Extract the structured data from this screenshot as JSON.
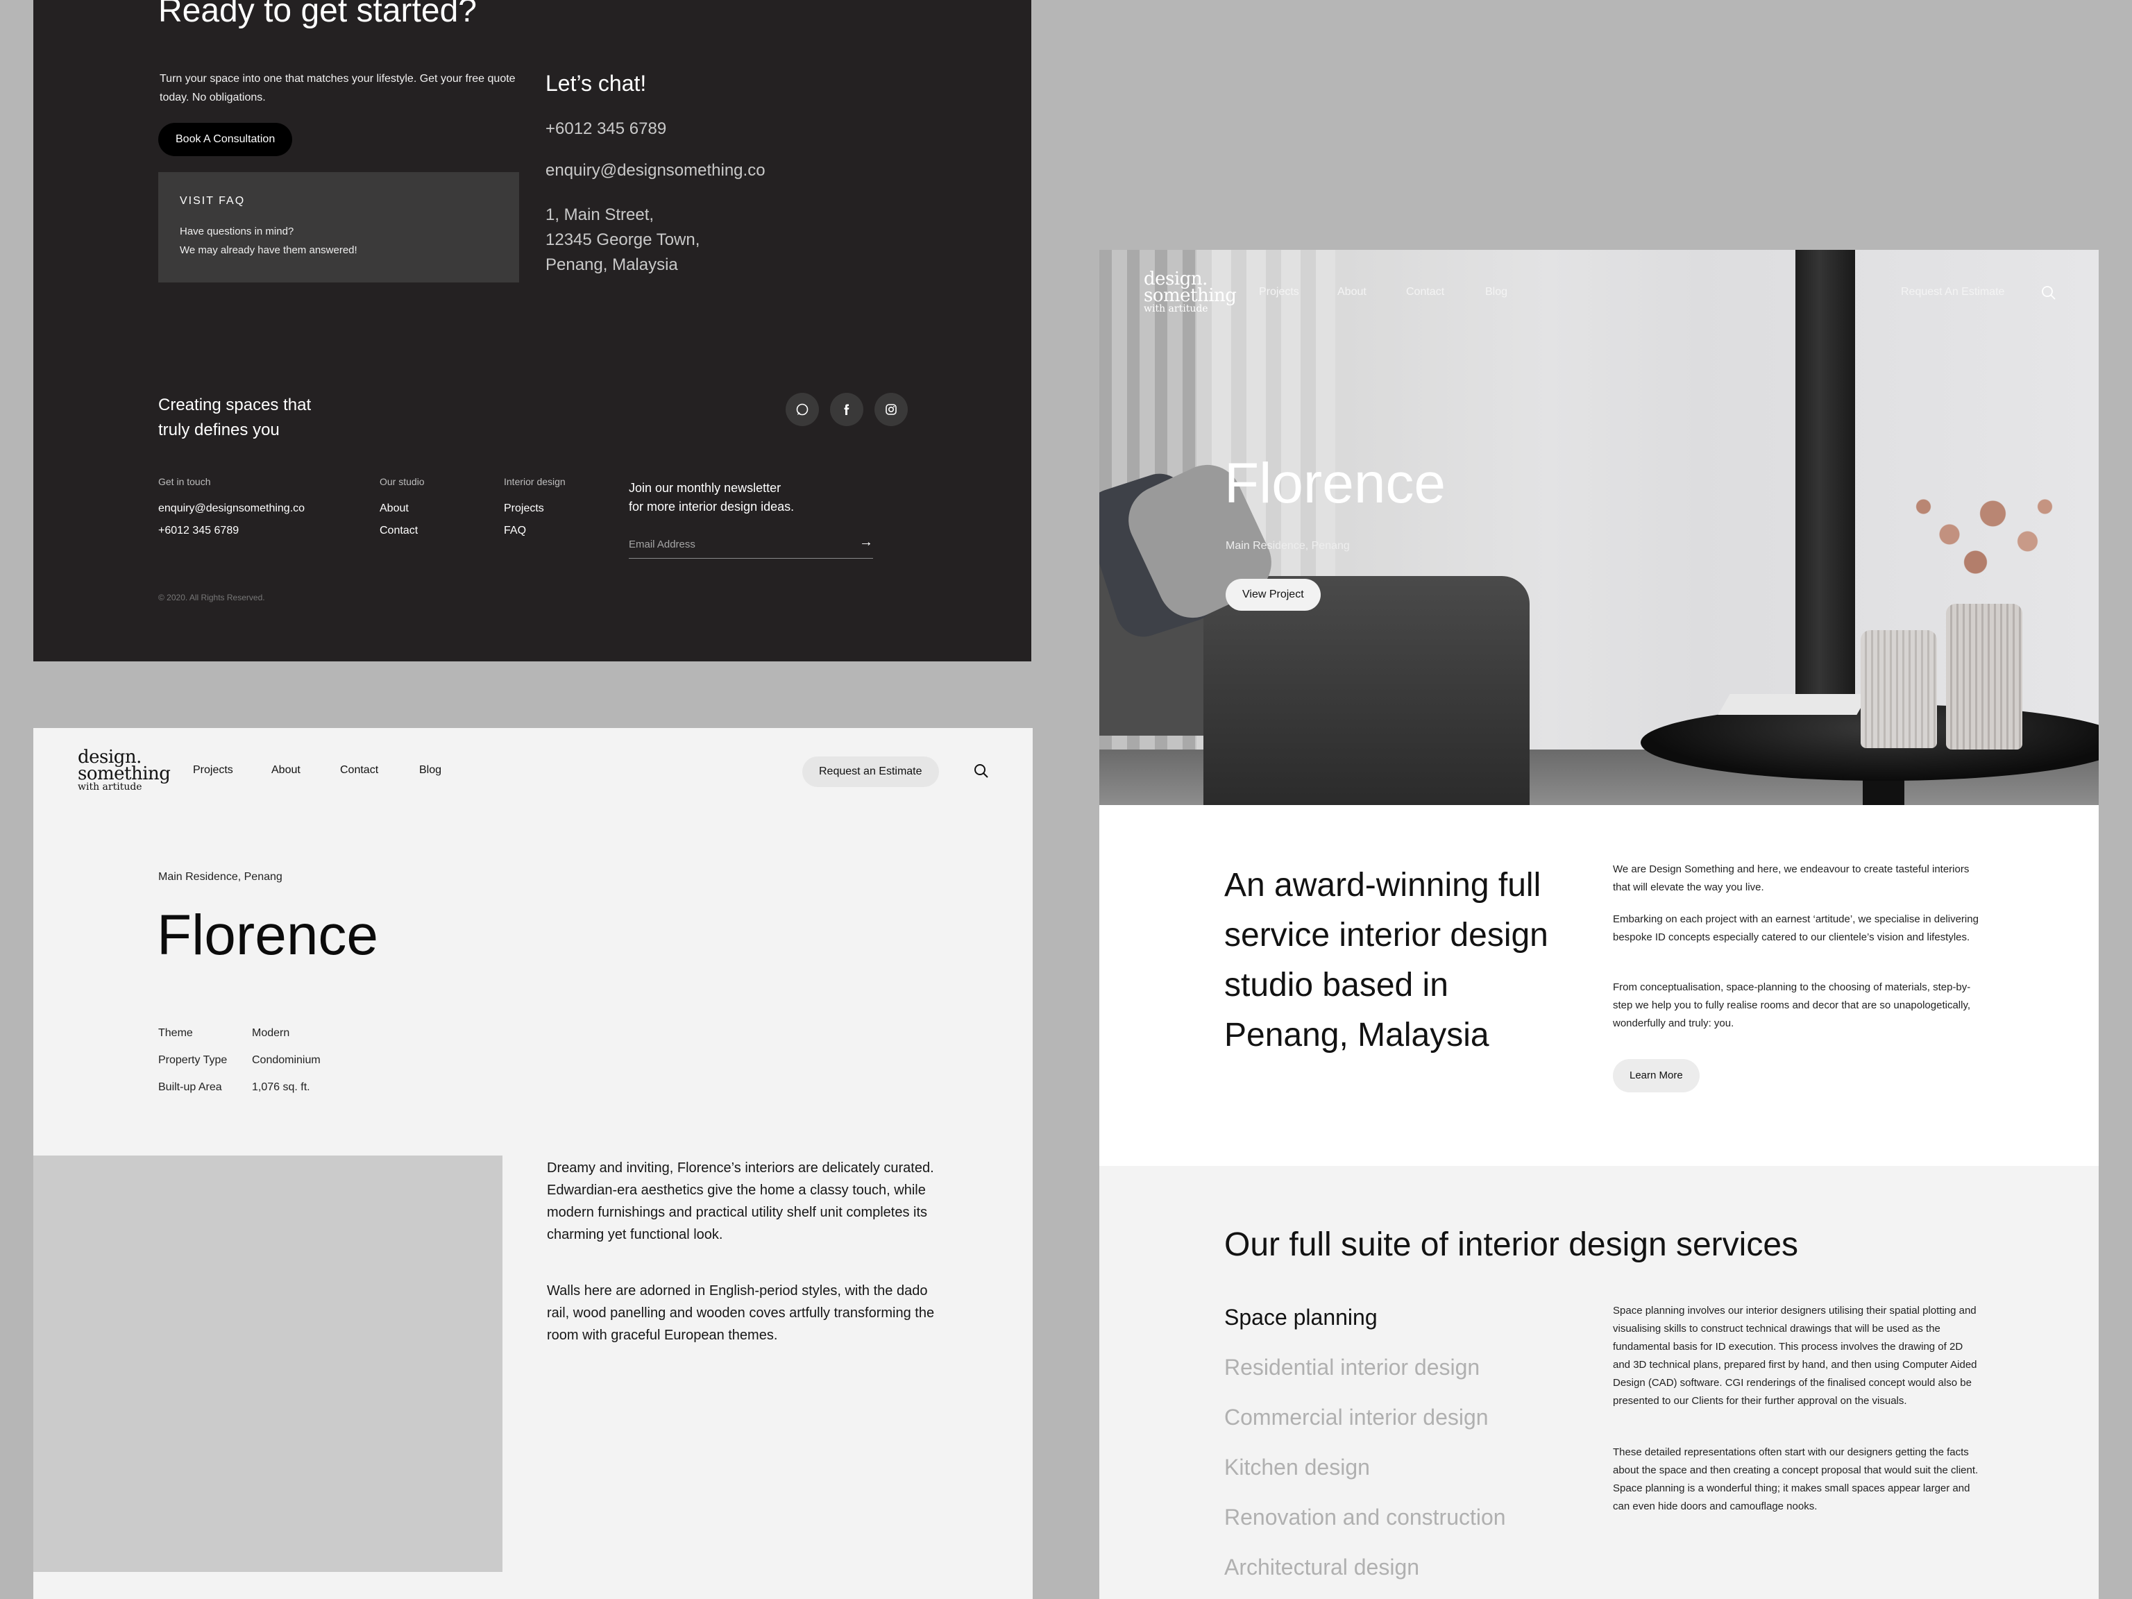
{
  "footer": {
    "title": "Ready to get started?",
    "intro": "Turn your space into one that matches your lifestyle. Get your free quote today. No obligations.",
    "consult_button": "Book A Consultation",
    "faq_label": "VISIT FAQ",
    "faq_line1": "Have questions in mind?",
    "faq_line2": "We may already have them answered!",
    "chat_heading": "Let’s chat!",
    "phone": "+6012 345 6789",
    "email": "enquiry@designsomething.co",
    "address_line1": "1, Main Street,",
    "address_line2": "12345 George Town,",
    "address_line3": "Penang, Malaysia",
    "tagline_line1": "Creating spaces that",
    "tagline_line2": "truly defines you",
    "social_icons": [
      "whatsapp-icon",
      "facebook-icon",
      "instagram-icon"
    ],
    "col_touch_heading": "Get in touch",
    "col_touch_email": "enquiry@designsomething.co",
    "col_touch_phone": "+6012 345 6789",
    "col_studio_heading": "Our studio",
    "col_studio_about": "About",
    "col_studio_contact": "Contact",
    "col_id_heading": "Interior design",
    "col_id_projects": "Projects",
    "col_id_faq": "FAQ",
    "newsletter_line1": "Join our monthly newsletter",
    "newsletter_line2": "for more interior design ideas.",
    "newsletter_placeholder": "Email Address",
    "copyright": "© 2020. All Rights Reserved."
  },
  "logo": {
    "line1": "design.",
    "line2": "something",
    "line3": "with artitude"
  },
  "project_page": {
    "nav": [
      "Projects",
      "About",
      "Contact",
      "Blog"
    ],
    "estimate_button": "Request an Estimate",
    "subtitle": "Main Residence, Penang",
    "title": "Florence",
    "specs": [
      {
        "key": "Theme",
        "value": "Modern"
      },
      {
        "key": "Property Type",
        "value": "Condominium"
      },
      {
        "key": "Built-up Area",
        "value": "1,076 sq. ft."
      }
    ],
    "paragraph1": "Dreamy and inviting, Florence’s interiors are delicately curated. Edwardian-era aesthetics give the home a classy touch, while modern furnishings and practical utility shelf unit completes its charming yet functional look.",
    "paragraph2": "Walls here are adorned in English-period styles, with the dado rail, wood panelling and wooden coves artfully transforming the room with graceful European themes."
  },
  "home_page": {
    "nav": [
      "Projects",
      "About",
      "Contact",
      "Blog"
    ],
    "estimate_link": "Request An Estimate",
    "hero_title": "Florence",
    "hero_subtitle": "Main Residence, Penang",
    "hero_button": "View Project",
    "about_heading": "An award-winning full service interior design studio based in Penang, Malaysia",
    "about_p1": "We are Design Something and here, we endeavour to create tasteful interiors that will elevate the way you live.",
    "about_p2": "Embarking on each project with an earnest ‘artitude’, we specialise in delivering bespoke ID concepts especially catered to our clientele’s vision and lifestyles.",
    "about_p3": "From conceptualisation, space-planning to the choosing of materials, step-by-step we help you to fully realise rooms and decor that are so unapologetically, wonderfully and truly: you.",
    "learn_more": "Learn More",
    "services_heading": "Our full suite of interior design services",
    "services": [
      "Space planning",
      "Residential interior design",
      "Commercial interior design",
      "Kitchen design",
      "Renovation and construction",
      "Architectural design"
    ],
    "services_p1": "Space planning involves our interior designers utilising their spatial plotting and visualising skills to construct technical drawings that will be used as the fundamental basis for ID execution. This process involves the drawing of 2D and 3D technical plans, prepared first by hand, and then using Computer Aided Design (CAD) software. CGI renderings of the finalised concept would also be presented to our Clients for their further approval on the visuals.",
    "services_p2": "These detailed representations often start with our designers getting the facts about the space and then creating a concept proposal that would suit the client. Space planning is a wonderful thing; it makes small spaces appear larger and can even hide doors and camouflage nooks."
  },
  "colors": {
    "page_bg": "#b6b6b6",
    "footer_bg": "#242122",
    "panel_light": "#f3f3f3",
    "accent_dark": "#000000"
  }
}
